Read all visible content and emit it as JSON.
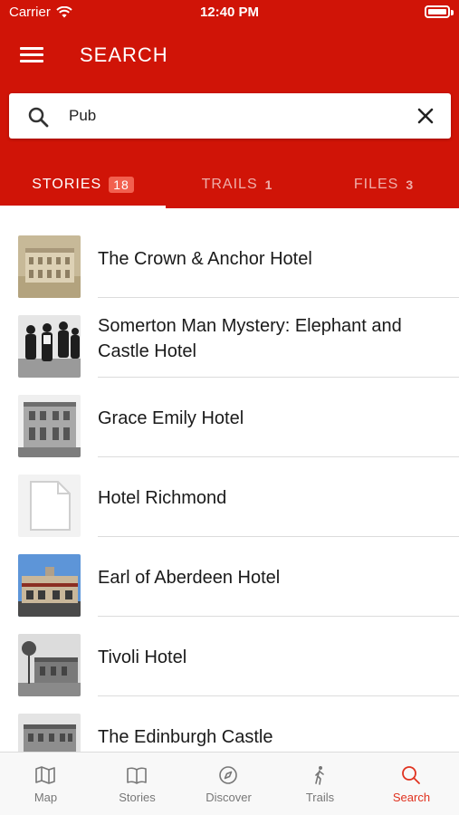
{
  "status_bar": {
    "carrier": "Carrier",
    "time": "12:40 PM"
  },
  "header": {
    "title": "SEARCH",
    "menu_icon": "hamburger-menu-icon"
  },
  "search": {
    "value": "Pub",
    "placeholder": ""
  },
  "tabs": [
    {
      "label": "STORIES",
      "count": "18",
      "active": true
    },
    {
      "label": "TRAILS",
      "count": "1",
      "active": false
    },
    {
      "label": "FILES",
      "count": "3",
      "active": false
    }
  ],
  "results": [
    {
      "title": "The Crown & Anchor Hotel",
      "thumb": "sepia-building-photo"
    },
    {
      "title": "Somerton Man Mystery: Elephant and Castle Hotel",
      "thumb": "bw-people-photo"
    },
    {
      "title": "Grace Emily Hotel",
      "thumb": "bw-hotel-photo"
    },
    {
      "title": "Hotel Richmond",
      "thumb": "document-placeholder-icon"
    },
    {
      "title": "Earl of Aberdeen Hotel",
      "thumb": "color-hotel-photo"
    },
    {
      "title": "Tivoli Hotel",
      "thumb": "bw-street-photo"
    },
    {
      "title": "The Edinburgh Castle",
      "thumb": "bw-castle-hotel-photo"
    }
  ],
  "bottom_nav": [
    {
      "label": "Map",
      "icon": "map-icon",
      "active": false
    },
    {
      "label": "Stories",
      "icon": "book-icon",
      "active": false
    },
    {
      "label": "Discover",
      "icon": "compass-icon",
      "active": false
    },
    {
      "label": "Trails",
      "icon": "walking-person-icon",
      "active": false
    },
    {
      "label": "Search",
      "icon": "search-icon",
      "active": true
    }
  ],
  "colors": {
    "brand_red": "#d01407",
    "active_nav": "#e0321f",
    "badge": "#f2604f"
  }
}
